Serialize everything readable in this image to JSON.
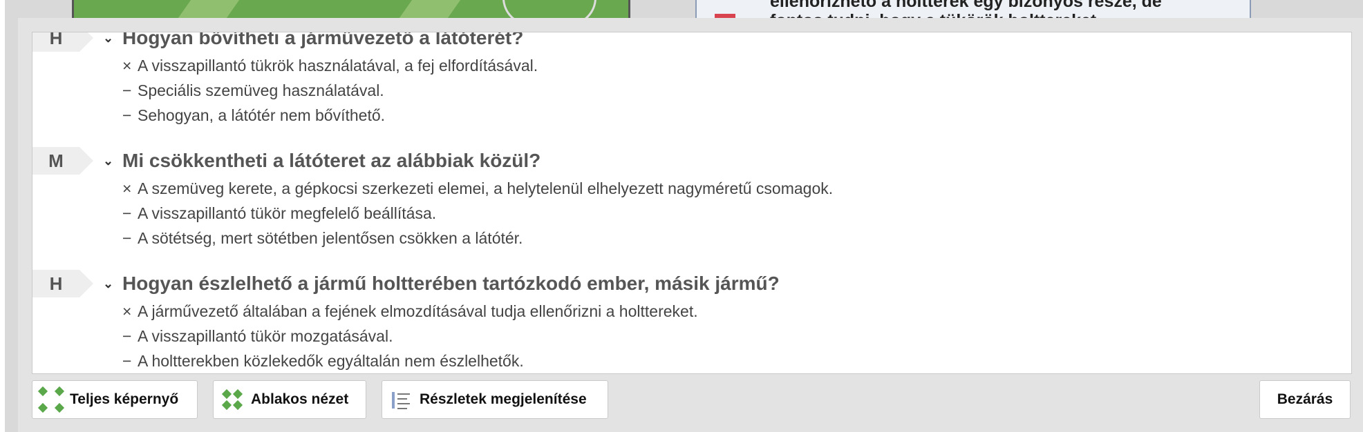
{
  "background": {
    "panel_text_line1": "ellenőrizhető a holtterek egy bizonyos része, de",
    "panel_text_line2": "fontos tudni, hogy a tükörök holttereket"
  },
  "questions": [
    {
      "badge": "H",
      "title": "Hogyan bővítheti a járművezető a látóterét?",
      "answers": [
        {
          "mark": "×",
          "text": "A visszapillantó tükrök használatával, a fej elfordításával."
        },
        {
          "mark": "−",
          "text": "Speciális szemüveg használatával."
        },
        {
          "mark": "−",
          "text": "Sehogyan, a látótér nem bővíthető."
        }
      ]
    },
    {
      "badge": "M",
      "title": "Mi csökkentheti a látóteret az alábbiak közül?",
      "answers": [
        {
          "mark": "×",
          "text": "A szemüveg kerete, a gépkocsi szerkezeti elemei, a helytelenül elhelyezett nagyméretű csomagok."
        },
        {
          "mark": "−",
          "text": "A visszapillantó tükör megfelelő beállítása."
        },
        {
          "mark": "−",
          "text": "A sötétség, mert sötétben jelentősen csökken a látótér."
        }
      ]
    },
    {
      "badge": "H",
      "title": "Hogyan észlelhető a jármű holtterében tartózkodó ember, másik jármű?",
      "answers": [
        {
          "mark": "×",
          "text": "A járművezető általában a fejének elmozdításával tudja ellenőrizni a holttereket."
        },
        {
          "mark": "−",
          "text": "A visszapillantó tükör mozgatásával."
        },
        {
          "mark": "−",
          "text": "A holtterekben közlekedők egyáltalán nem észlelhetők."
        }
      ]
    }
  ],
  "toolbar": {
    "fullscreen": {
      "label": "Teljes képernyő",
      "icon": "fullscreen-icon"
    },
    "windowed": {
      "label": "Ablakos nézet",
      "icon": "windowed-icon"
    },
    "details": {
      "label": "Részletek megjelenítése",
      "icon": "list-icon"
    },
    "close": {
      "label": "Bezárás"
    }
  },
  "colors": {
    "icon_green": "#5ba84a",
    "badge_bg": "#eeeeee"
  }
}
